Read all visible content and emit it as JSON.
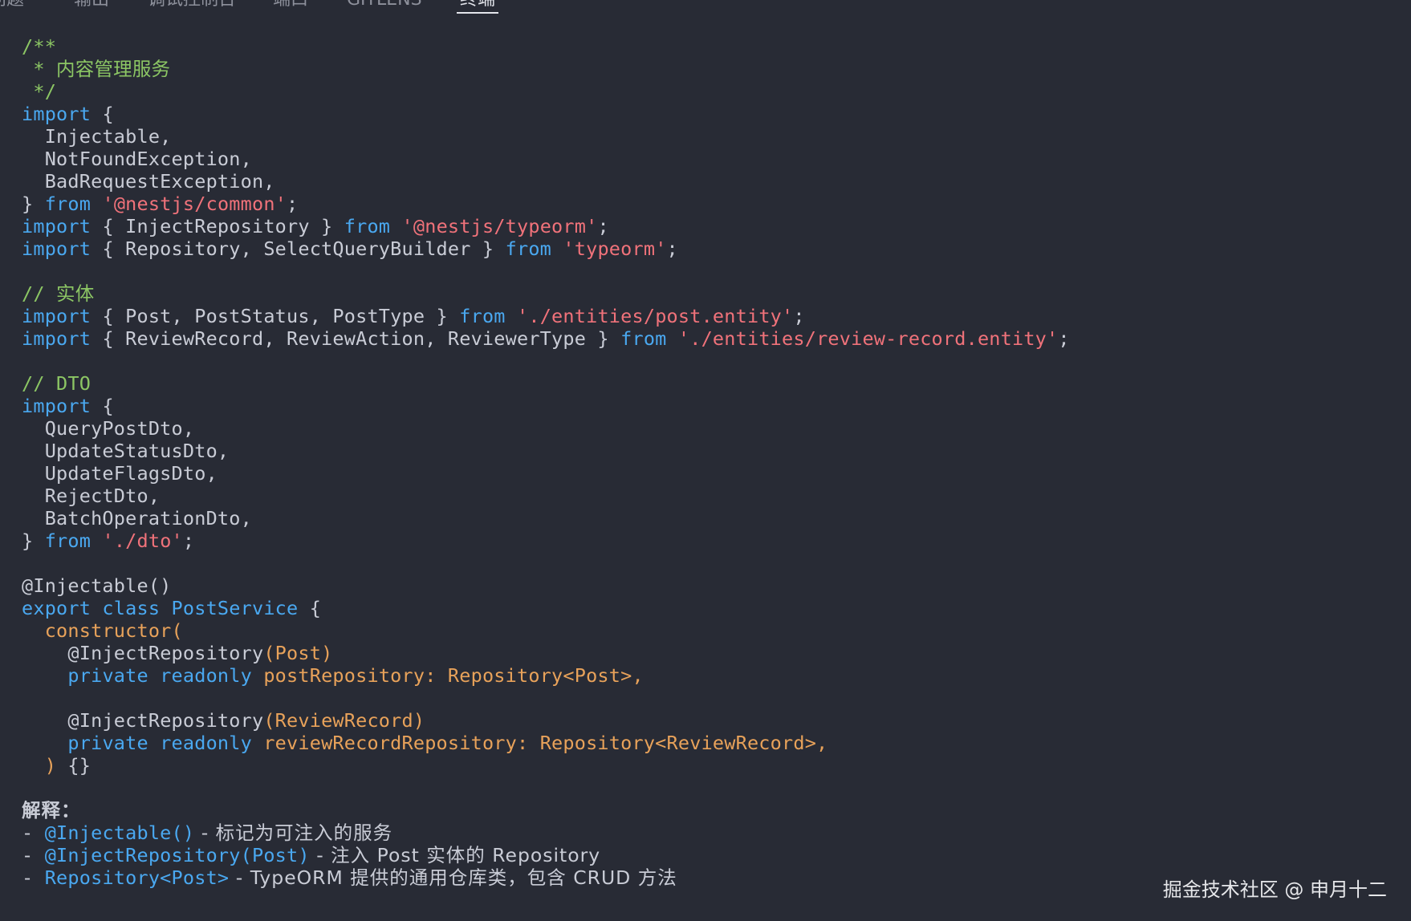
{
  "tabs": [
    {
      "label": "问题"
    },
    {
      "label": "输出"
    },
    {
      "label": "调试控制台"
    },
    {
      "label": "端口"
    },
    {
      "label": "GITLENS"
    },
    {
      "label": "终端"
    }
  ],
  "active_tab": "终端",
  "code": {
    "comment_open": "/**",
    "comment_title": " * 内容管理服务",
    "comment_close": " */",
    "kw_import": "import",
    "kw_from": "from",
    "brace_open": " {",
    "injectable": "  Injectable,",
    "notfound": "  NotFoundException,",
    "badrequest": "  BadRequestException,",
    "close_brace": "} ",
    "str_common": "'@nestjs/common'",
    "semi": ";",
    "inject_repo_import": " { InjectRepository } ",
    "str_nest_typeorm": "'@nestjs/typeorm'",
    "repo_import": " { Repository, SelectQueryBuilder } ",
    "str_typeorm": "'typeorm'",
    "comment_entity": "// 实体",
    "post_import": " { Post, PostStatus, PostType } ",
    "str_post_entity": "'./entities/post.entity'",
    "review_import": " { ReviewRecord, ReviewAction, ReviewerType } ",
    "str_review_entity": "'./entities/review-record.entity'",
    "comment_dto": "// DTO",
    "dto1": "  QueryPostDto,",
    "dto2": "  UpdateStatusDto,",
    "dto3": "  UpdateFlagsDto,",
    "dto4": "  RejectDto,",
    "dto5": "  BatchOperationDto,",
    "str_dto": "'./dto'",
    "decorator_injectable": "@Injectable()",
    "kw_export_class": "export class",
    "class_name": " PostService",
    "class_brace": " {",
    "constructor": "  constructor(",
    "indent4": "    ",
    "inject_repo": "@InjectRepository",
    "arg_post": "(Post)",
    "kw_private_readonly": "private readonly",
    "post_repo_param": " postRepository: Repository<Post>,",
    "arg_review": "(ReviewRecord)",
    "review_repo_param": " reviewRecordRepository: Repository<ReviewRecord>,",
    "paren_close": "  )",
    "empty_body": " {}"
  },
  "explanation": {
    "title": "解释：",
    "dash": "- ",
    "item1_code": "@Injectable()",
    "item1_text": " - 标记为可注入的服务",
    "item2_code": "@InjectRepository(Post)",
    "item2_text": " - 注入 Post 实体的 Repository",
    "item3_code": "Repository<Post>",
    "item3_text": " - TypeORM 提供的通用仓库类，包含 CRUD 方法"
  },
  "watermark": "掘金技术社区 @ 申月十二",
  "colors": {
    "background": "#282b35",
    "keyword": "#4aa8f0",
    "string": "#f0727a",
    "comment": "#8cc664",
    "orange": "#e8a25a",
    "text": "#c9ccd6"
  }
}
